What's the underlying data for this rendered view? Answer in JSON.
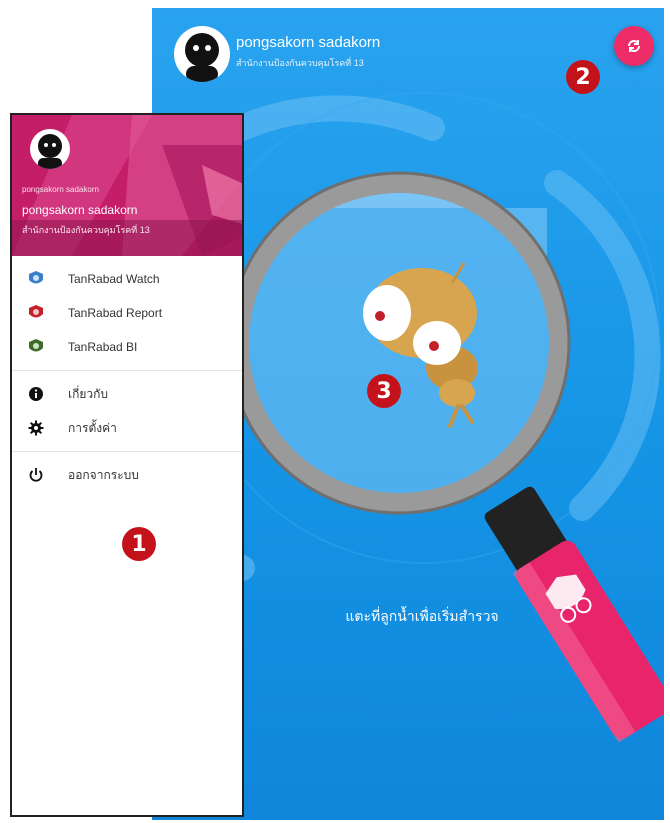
{
  "app": {
    "user_name": "pongsakorn sadakorn",
    "user_org": "สำนักงานป้องกันควบคุมโรคที่ 13",
    "prompt": "แตะที่ลูกน้ำเพื่อเริ่มสำรวจ",
    "sync_icon": "sync-icon",
    "accent_color": "#ee2d68",
    "background_color": "#1a97e8"
  },
  "drawer": {
    "small_text": "pongsakorn sadakorn",
    "user_name": "pongsakorn sadakorn",
    "user_org": "สำนักงานป้องกันควบคุมโรคที่ 13",
    "items": [
      {
        "label": "TanRabad Watch",
        "icon": "watch-app-icon",
        "color": "#3b7ec9"
      },
      {
        "label": "TanRabad Report",
        "icon": "report-app-icon",
        "color": "#c4202b"
      },
      {
        "label": "TanRabad BI",
        "icon": "bi-app-icon",
        "color": "#3f6b2a"
      },
      {
        "label": "เกี่ยวกับ",
        "icon": "info-icon"
      },
      {
        "label": "การตั้งค่า",
        "icon": "settings-icon"
      },
      {
        "label": "ออกจากระบบ",
        "icon": "power-icon"
      }
    ]
  },
  "markers": [
    "1",
    "2",
    "3"
  ]
}
